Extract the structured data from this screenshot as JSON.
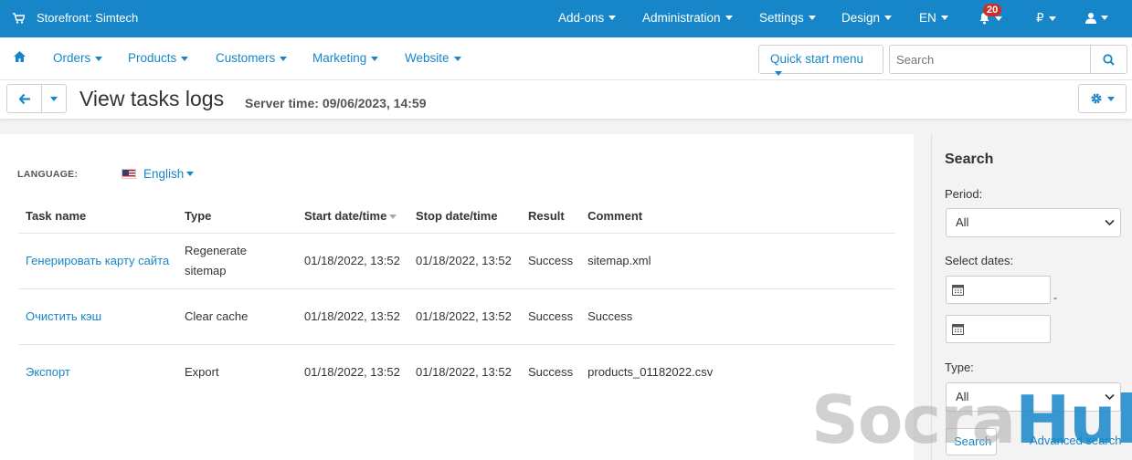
{
  "topbar": {
    "store": "Storefront: Simtech",
    "menus": [
      "Add-ons",
      "Administration",
      "Settings",
      "Design",
      "EN"
    ],
    "notifications_count": "20",
    "currency": "₽"
  },
  "nav": {
    "items": [
      "Orders",
      "Products",
      "Customers",
      "Marketing",
      "Website"
    ],
    "quick_start": "Quick start menu",
    "search_placeholder": "Search"
  },
  "page": {
    "title": "View tasks logs",
    "server_time": "Server time: 09/06/2023, 14:59"
  },
  "language": {
    "label": "LANGUAGE:",
    "value": "English"
  },
  "table": {
    "headers": [
      "Task name",
      "Type",
      "Start date/time",
      "Stop date/time",
      "Result",
      "Comment"
    ],
    "rows": [
      {
        "task": "Генерировать карту сайта",
        "type": "Regenerate sitemap",
        "start": "01/18/2022, 13:52",
        "stop": "01/18/2022, 13:52",
        "result": "Success",
        "comment": "sitemap.xml"
      },
      {
        "task": "Очистить кэш",
        "type": "Clear cache",
        "start": "01/18/2022, 13:52",
        "stop": "01/18/2022, 13:52",
        "result": "Success",
        "comment": "Success"
      },
      {
        "task": "Экспорт",
        "type": "Export",
        "start": "01/18/2022, 13:52",
        "stop": "01/18/2022, 13:52",
        "result": "Success",
        "comment": "products_01182022.csv"
      }
    ]
  },
  "sidebar": {
    "title": "Search",
    "period_label": "Period:",
    "period_value": "All",
    "dates_label": "Select dates:",
    "date_separator": "-",
    "type_label": "Type:",
    "type_value": "All",
    "search_button": "Search",
    "advanced_link": "Advanced search"
  },
  "watermark": {
    "part1": "Socra",
    "part2": "Hub"
  },
  "colors": {
    "accent": "#1686c9",
    "topbar": "#1686c9",
    "badge": "#c9302c"
  }
}
